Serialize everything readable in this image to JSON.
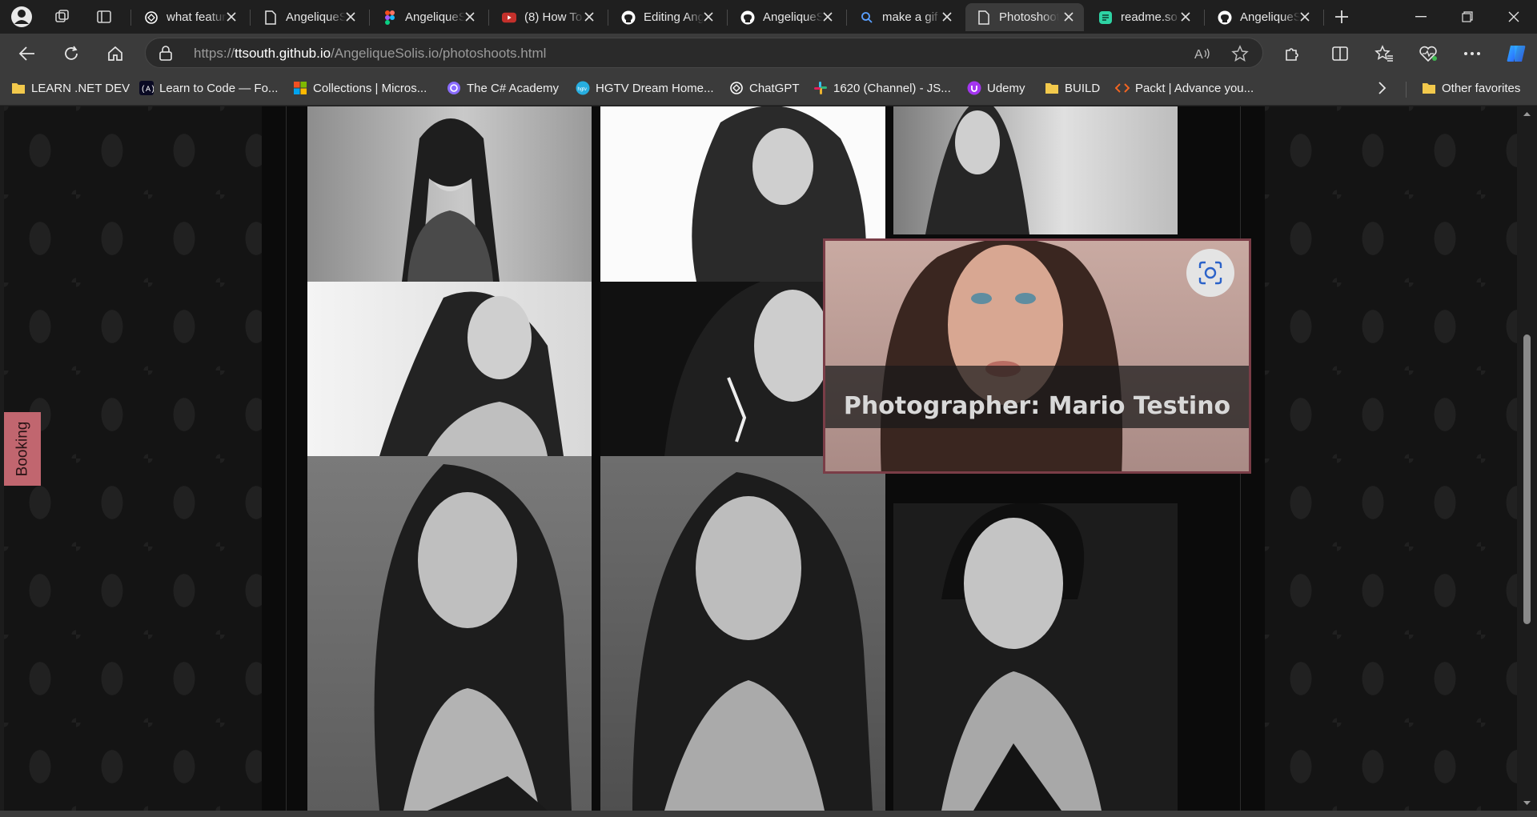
{
  "tabs": [
    {
      "title": "what features",
      "icon": "openai-icon",
      "active": false
    },
    {
      "title": "AngeliqueSolis",
      "icon": "page-icon",
      "active": false
    },
    {
      "title": "AngeliqueSolis",
      "icon": "figma-icon",
      "active": false
    },
    {
      "title": "(8) How To",
      "icon": "youtube-icon",
      "active": false
    },
    {
      "title": "Editing Angelique",
      "icon": "github-icon",
      "active": false
    },
    {
      "title": "AngeliqueSolis",
      "icon": "github-icon",
      "active": false
    },
    {
      "title": "make a gif",
      "icon": "search-icon",
      "active": false
    },
    {
      "title": "Photoshoots",
      "icon": "page-icon",
      "active": true
    },
    {
      "title": "readme.so",
      "icon": "readme-icon",
      "active": false
    },
    {
      "title": "AngeliqueSolis",
      "icon": "github-icon",
      "active": false
    }
  ],
  "address": {
    "url_prefix": "https://",
    "url_host": "ttsouth.github.io",
    "url_path": "/AngeliqueSolis.io/photoshoots.html"
  },
  "bookmarks": [
    {
      "label": "LEARN .NET DEV",
      "icon": "folder-icon"
    },
    {
      "label": "Learn to Code — Fo...",
      "icon": "freecodecamp-icon"
    },
    {
      "label": "Collections | Micros...",
      "icon": "microsoft-icon"
    },
    {
      "label": "The C# Academy",
      "icon": "csharp-academy-icon"
    },
    {
      "label": "HGTV Dream Home...",
      "icon": "hgtv-icon"
    },
    {
      "label": "ChatGPT",
      "icon": "openai-icon"
    },
    {
      "label": "1620 (Channel) - JS...",
      "icon": "slack-icon"
    },
    {
      "label": "Udemy",
      "icon": "udemy-icon"
    },
    {
      "label": "BUILD",
      "icon": "folder-icon"
    },
    {
      "label": "Packt | Advance you...",
      "icon": "packt-icon"
    }
  ],
  "other_favorites": "Other favorites",
  "page": {
    "booking_label": "Booking",
    "popup_caption": "Photographer: Mario Testino",
    "gallery": [
      {
        "name": "portrait-1",
        "style": "grey"
      },
      {
        "name": "portrait-2",
        "style": "white"
      },
      {
        "name": "portrait-3",
        "style": "grey"
      },
      {
        "name": "portrait-4",
        "style": "light"
      },
      {
        "name": "portrait-5",
        "style": "dark"
      },
      {
        "name": "portrait-7",
        "style": "grey"
      },
      {
        "name": "portrait-8",
        "style": "grey"
      },
      {
        "name": "portrait-9",
        "style": "dark"
      }
    ]
  },
  "colors": {
    "accent_booking": "#c1666f",
    "popup_border": "#7a3d47",
    "chrome_bg": "#3b3b3b"
  }
}
